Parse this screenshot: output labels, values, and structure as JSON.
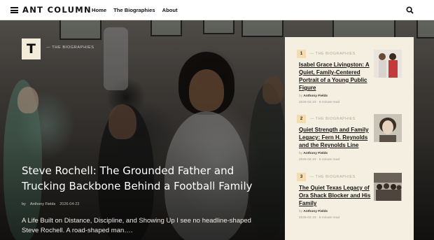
{
  "site": {
    "logo": "ANT COLUMN",
    "nav": [
      "Home",
      "The Biographies",
      "About"
    ]
  },
  "icons": {
    "menu": "hamburger-menu-icon",
    "search": "search-icon"
  },
  "hero": {
    "badge_letter": "T",
    "category": "— THE BIOGRAPHIES",
    "title": "Steve Rochell: The Grounded Father and Trucking Backbone Behind a Football Family",
    "by": "by",
    "author": "Anthony Fields",
    "date": "2026-04-23",
    "excerpt": "A Life Built on Distance, Discipline, and Showing Up I see no headline-shaped Steve Rochell. A road-shaped man…."
  },
  "sidebar": {
    "items": [
      {
        "num": "1",
        "category": "— THE BIOGRAPHIES",
        "title": "Isabel Grace Livingston: A Quiet, Family-Centered Portrait of a Young Public Figure",
        "by": "by",
        "author": "Anthony Fields",
        "date": "2026-04-23",
        "read": "6 minute read"
      },
      {
        "num": "2",
        "category": "— THE BIOGRAPHIES",
        "title": "Quiet Strength and Family Legacy: Fern H. Reynolds and the Reynolds Line",
        "by": "by",
        "author": "Anthony Fields",
        "date": "2026-04-23",
        "read": "5 minute read"
      },
      {
        "num": "3",
        "category": "— THE BIOGRAPHIES",
        "title": "The Quiet Texas Legacy of Ora Shack Blocker and His Family",
        "by": "by",
        "author": "Anthony Fields",
        "date": "2026-04-23",
        "read": "6 minute read"
      }
    ]
  },
  "colors": {
    "header_bg": "#ffffff",
    "sidebar_bg": "#f5efe1",
    "badge_bg": "#f3ecd9",
    "number_bg": "#f2dcb0"
  }
}
